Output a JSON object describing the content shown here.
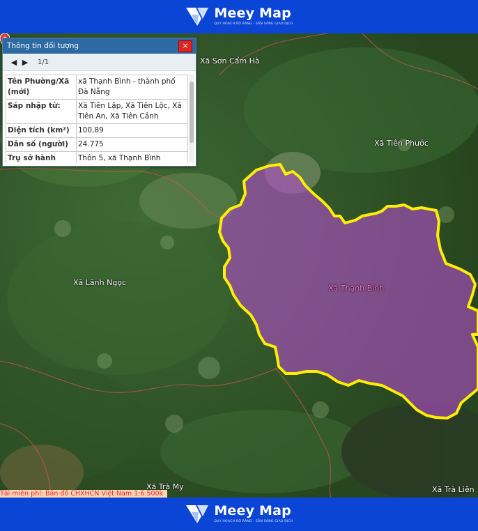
{
  "brand": {
    "name": "Meey Map",
    "tagline": "QUY HOẠCH RÕ RÀNG - SẴN SÀNG GIAO DỊCH"
  },
  "popup": {
    "title": "Thông tin đối tượng",
    "close": "×",
    "pager": "1/1",
    "rows": [
      {
        "key": "Tên Phường/Xã (mới)",
        "value": "xã Thạnh Bình - thành phố Đà Nẵng"
      },
      {
        "key": "Sáp nhập từ:",
        "value": "Xã Tiên Lập, Xã Tiên Lộc, Xã Tiên An, Xã Tiên Cảnh"
      },
      {
        "key": "Diện tích (km²)",
        "value": "100,89"
      },
      {
        "key": "Dân số (người)",
        "value": "24.775"
      },
      {
        "key": "Trụ sở hành chính (mới)",
        "value": "Thôn 5, xã Thạnh Bình"
      }
    ]
  },
  "map": {
    "labels": {
      "son_cam_ha": "Xã Sơn Cẩm Hà",
      "tien_phuoc": "Xã Tiên Phước",
      "lanh_ngoc": "Xã Lãnh Ngọc",
      "thanh_binh": "Xã Thạnh Bình",
      "tra_my": "Xã Trà My",
      "tra_lien": "Xã Trà Liên"
    },
    "disclaimer": "Tải miễn phí: Bản đồ CHXHCN Việt Nam 1:6.500k",
    "colors": {
      "boundary": "#ffee00",
      "fill": "#b04ec8",
      "banner": "#0b45d6"
    }
  }
}
